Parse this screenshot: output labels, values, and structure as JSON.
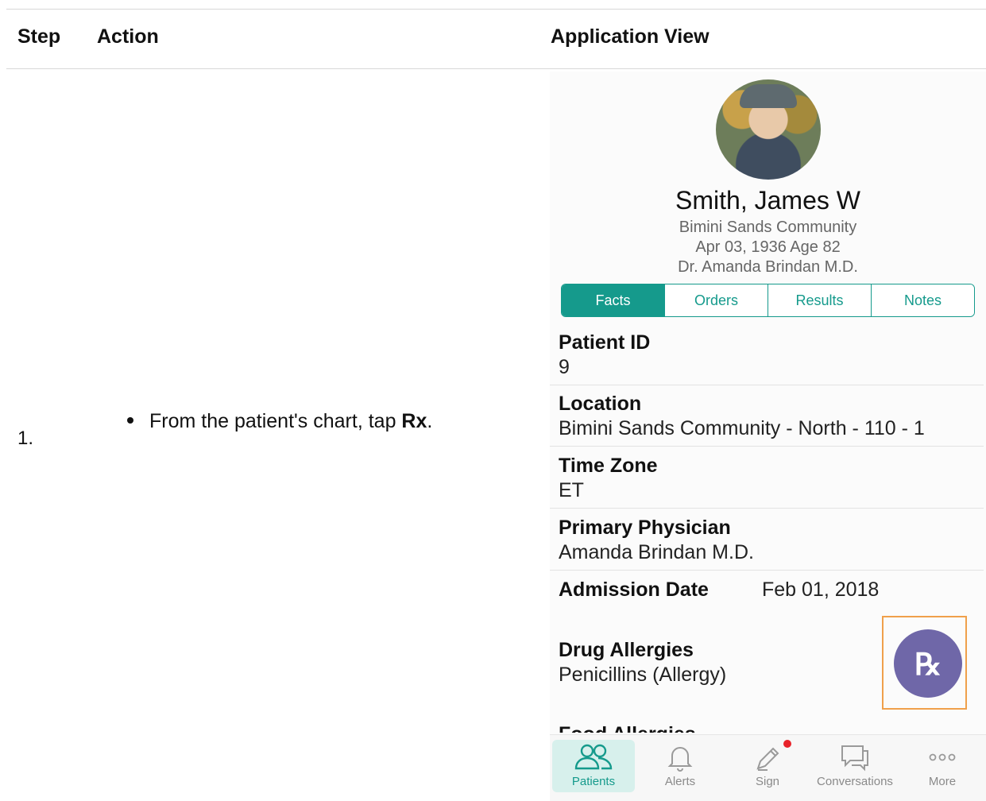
{
  "table": {
    "headers": {
      "step": "Step",
      "action": "Action",
      "view": "Application View"
    },
    "row": {
      "step": "1.",
      "action_prefix": "From the patient's chart, tap ",
      "action_bold": "Rx",
      "action_suffix": "."
    }
  },
  "app": {
    "patient": {
      "name": "Smith, James W",
      "community": "Bimini Sands Community",
      "dob_age": "Apr 03, 1936  Age 82",
      "physician_line": "Dr. Amanda Brindan M.D."
    },
    "tabs": [
      "Facts",
      "Orders",
      "Results",
      "Notes"
    ],
    "active_tab": "Facts",
    "fields": [
      {
        "label": "Patient ID",
        "value": "9"
      },
      {
        "label": "Location",
        "value": "Bimini Sands Community  - North - 110 - 1"
      },
      {
        "label": "Time Zone",
        "value": "ET"
      },
      {
        "label": "Primary Physician",
        "value": "Amanda Brindan M.D."
      },
      {
        "label": "Admission Date",
        "value": "Feb 01, 2018"
      },
      {
        "label": "Drug Allergies",
        "value": "Penicillins (Allergy)"
      },
      {
        "label": "Food Allergies",
        "value": ""
      }
    ],
    "rx_button": "℞",
    "tabbar": [
      {
        "label": "Patients",
        "icon": "patients-icon"
      },
      {
        "label": "Alerts",
        "icon": "bell-icon"
      },
      {
        "label": "Sign",
        "icon": "pen-icon"
      },
      {
        "label": "Conversations",
        "icon": "chat-icon"
      },
      {
        "label": "More",
        "icon": "more-icon"
      }
    ],
    "colors": {
      "accent": "#159a8c",
      "rx": "#6f67a8",
      "highlight": "#f0a04b",
      "badge": "#e8232a"
    }
  }
}
